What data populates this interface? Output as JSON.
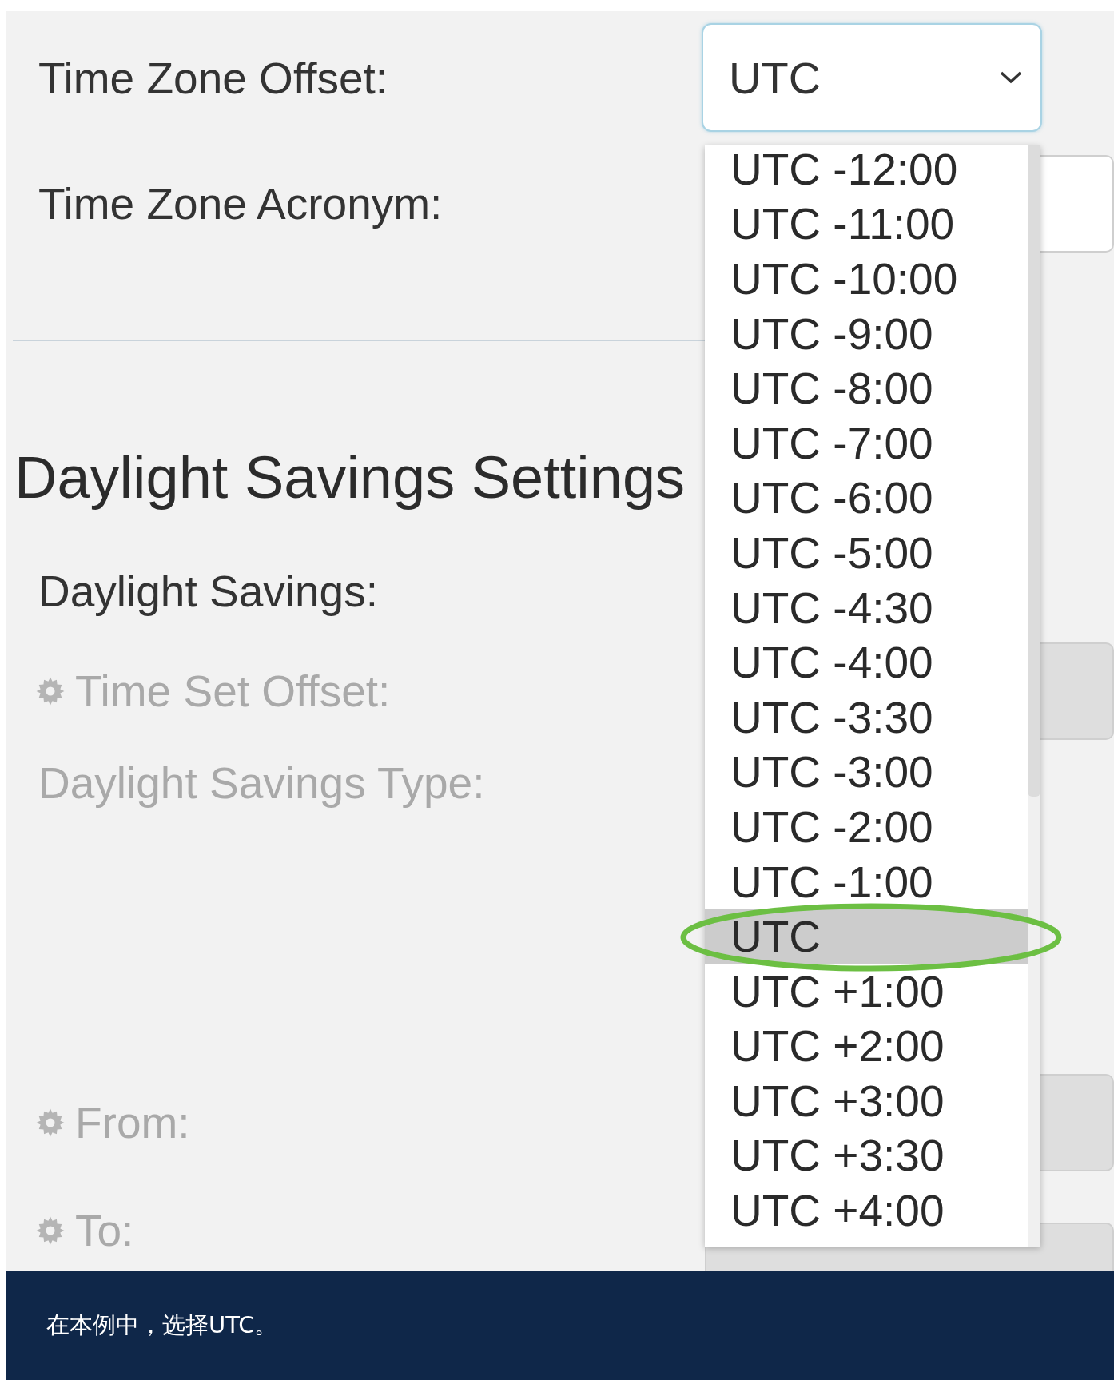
{
  "form": {
    "time_zone_offset": {
      "label": "Time Zone Offset:",
      "value": "UTC",
      "expanded": true
    },
    "time_zone_acronym": {
      "label": "Time Zone Acronym:"
    },
    "section_title": "Daylight Savings Settings",
    "daylight_savings": {
      "label": "Daylight Savings:",
      "disabled": false
    },
    "time_set_offset": {
      "label": "Time Set Offset:",
      "disabled": true
    },
    "daylight_savings_type": {
      "label": "Daylight Savings Type:",
      "disabled": true
    },
    "from": {
      "label": "From:",
      "disabled": true
    },
    "to": {
      "label": "To:",
      "disabled": true
    }
  },
  "dropdown": {
    "options": [
      {
        "label": "UTC -12:00",
        "selected": false
      },
      {
        "label": "UTC -11:00",
        "selected": false
      },
      {
        "label": "UTC -10:00",
        "selected": false
      },
      {
        "label": "UTC -9:00",
        "selected": false
      },
      {
        "label": "UTC -8:00",
        "selected": false
      },
      {
        "label": "UTC -7:00",
        "selected": false
      },
      {
        "label": "UTC -6:00",
        "selected": false
      },
      {
        "label": "UTC -5:00",
        "selected": false
      },
      {
        "label": "UTC -4:30",
        "selected": false
      },
      {
        "label": "UTC -4:00",
        "selected": false
      },
      {
        "label": "UTC -3:30",
        "selected": false
      },
      {
        "label": "UTC -3:00",
        "selected": false
      },
      {
        "label": "UTC -2:00",
        "selected": false
      },
      {
        "label": "UTC -1:00",
        "selected": false
      },
      {
        "label": "UTC",
        "selected": true
      },
      {
        "label": "UTC +1:00",
        "selected": false
      },
      {
        "label": "UTC +2:00",
        "selected": false
      },
      {
        "label": "UTC +3:00",
        "selected": false
      },
      {
        "label": "UTC +3:30",
        "selected": false
      },
      {
        "label": "UTC +4:00",
        "selected": false
      }
    ],
    "callout": {
      "kind": "ellipse"
    }
  },
  "caption": "在本例中，选择UTC。"
}
